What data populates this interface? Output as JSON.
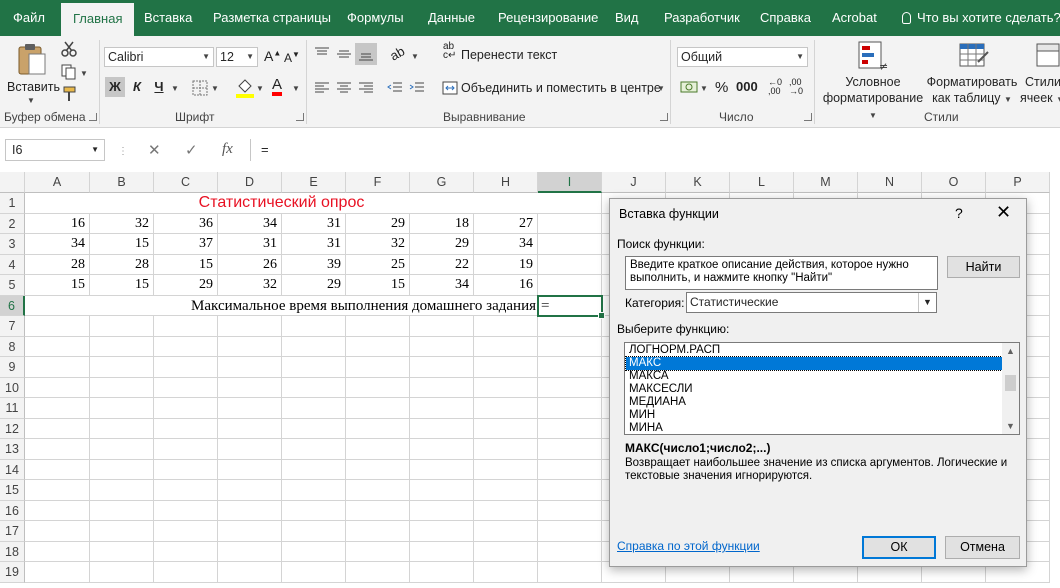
{
  "tabs": [
    "Файл",
    "Главная",
    "Вставка",
    "Разметка страницы",
    "Формулы",
    "Данные",
    "Рецензирование",
    "Вид",
    "Разработчик",
    "Справка",
    "Acrobat"
  ],
  "active_tab": "Главная",
  "tell_me": "Что вы хотите сделать?",
  "ribbon": {
    "paste_label": "Вставить",
    "group_clipboard": "Буфер обмена",
    "group_font": "Шрифт",
    "group_alignment": "Выравнивание",
    "group_number": "Число",
    "group_styles": "Стили",
    "font_name": "Calibri",
    "font_size": "12",
    "bold": "Ж",
    "italic": "К",
    "underline": "Ч",
    "wrap_text": "Перенести текст",
    "merge_center": "Объединить и поместить в центре",
    "number_format": "Общий",
    "conditional_formatting_line1": "Условное",
    "conditional_formatting_line2": "форматирование",
    "format_table_line1": "Форматировать",
    "format_table_line2": "как таблицу",
    "cell_styles_line1": "Стили",
    "cell_styles_line2": "ячеек"
  },
  "formula_bar": {
    "name_box": "I6",
    "formula": "=",
    "fx": "fx"
  },
  "sheet": {
    "columns": [
      "A",
      "B",
      "C",
      "D",
      "E",
      "F",
      "G",
      "H",
      "I",
      "J",
      "K",
      "L",
      "M",
      "N",
      "O",
      "P"
    ],
    "selected_column": "I",
    "rows": [
      "1",
      "2",
      "3",
      "4",
      "5",
      "6",
      "7",
      "8",
      "9",
      "10",
      "11",
      "12",
      "13",
      "14",
      "15",
      "16",
      "17",
      "18",
      "19"
    ],
    "selected_row": "6",
    "title": "Статистический опрос",
    "data": [
      [
        "16",
        "32",
        "36",
        "34",
        "31",
        "29",
        "18",
        "27"
      ],
      [
        "34",
        "15",
        "37",
        "31",
        "31",
        "32",
        "29",
        "34"
      ],
      [
        "28",
        "28",
        "15",
        "26",
        "39",
        "25",
        "22",
        "19"
      ],
      [
        "15",
        "15",
        "29",
        "32",
        "29",
        "15",
        "34",
        "16"
      ]
    ],
    "row6_label": "Максимальное время выполнения домашнего задания",
    "active_cell_value": "="
  },
  "dialog": {
    "title": "Вставка функции",
    "help": "?",
    "close": "✕",
    "search_label": "Поиск функции:",
    "search_text": "Введите краткое описание действия, которое нужно выполнить, и нажмите кнопку \"Найти\"",
    "find_button": "Найти",
    "category_label": "Категория:",
    "category_value": "Статистические",
    "choose_label": "Выберите функцию:",
    "functions": [
      "ЛОГНОРМ.РАСП",
      "МАКС",
      "МАКСА",
      "МАКСЕСЛИ",
      "МЕДИАНА",
      "МИН",
      "МИНА"
    ],
    "selected_function": "МАКС",
    "signature": "МАКС(число1;число2;...)",
    "description": "Возвращает наибольшее значение из списка аргументов. Логические и текстовые значения игнорируются.",
    "help_link": "Справка по этой функции",
    "ok_button": "ОК",
    "cancel_button": "Отмена"
  },
  "colors": {
    "excel_green": "#217346",
    "title_red": "#e81123",
    "selection_blue": "#0078d7",
    "link_blue": "#0066cc"
  }
}
